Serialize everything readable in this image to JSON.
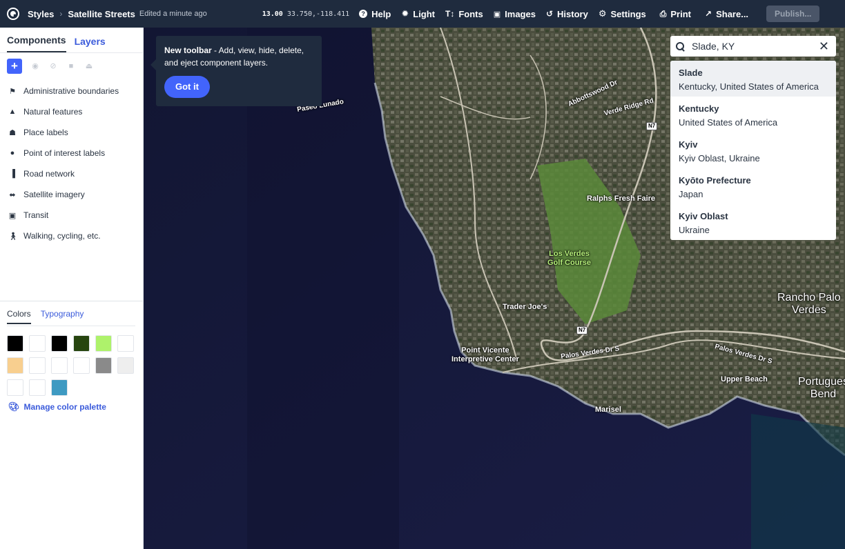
{
  "topbar": {
    "breadcrumb_root": "Styles",
    "style_name": "Satellite Streets",
    "edited": "Edited a minute ago",
    "zoom": "13.00",
    "coords": "33.750,-118.411",
    "buttons": {
      "help": "Help",
      "light": "Light",
      "fonts": "Fonts",
      "images": "Images",
      "history": "History",
      "settings": "Settings",
      "print": "Print",
      "share": "Share...",
      "publish": "Publish..."
    }
  },
  "sidebar": {
    "tabs": [
      "Components",
      "Layers"
    ],
    "components": [
      {
        "label": "Administrative boundaries",
        "icon": "flag-icon"
      },
      {
        "label": "Natural features",
        "icon": "mountain-icon"
      },
      {
        "label": "Place labels",
        "icon": "city-icon"
      },
      {
        "label": "Point of interest labels",
        "icon": "pin-icon"
      },
      {
        "label": "Road network",
        "icon": "road-icon"
      },
      {
        "label": "Satellite imagery",
        "icon": "satellite-icon"
      },
      {
        "label": "Transit",
        "icon": "transit-icon"
      },
      {
        "label": "Walking, cycling, etc.",
        "icon": "walking-icon"
      }
    ],
    "subtabs": [
      "Colors",
      "Typography"
    ],
    "colors": [
      "#000000",
      "#ffffff",
      "#000000",
      "#27450f",
      "#aef26b",
      "#ffffff",
      "#f8cf8f",
      "#ffffff",
      "#ffffff",
      "#ffffff",
      "#8a8a8a",
      "#eeeeee",
      "#ffffff",
      "#ffffff",
      "#3e9ac2"
    ],
    "manage_palette": "Manage color palette"
  },
  "tooltip": {
    "title": "New toolbar",
    "body": " - Add, view, hide, delete, and eject component layers.",
    "button": "Got it"
  },
  "search": {
    "value": "Slade, KY",
    "results": [
      {
        "title": "Slade",
        "subtitle": "Kentucky, United States of America"
      },
      {
        "title": "Kentucky",
        "subtitle": "United States of America"
      },
      {
        "title": "Kyiv",
        "subtitle": "Kyiv Oblast, Ukraine"
      },
      {
        "title": "Kyōto Prefecture",
        "subtitle": "Japan"
      },
      {
        "title": "Kyiv Oblast",
        "subtitle": "Ukraine"
      }
    ]
  },
  "map_labels": {
    "ralphs": "Ralphs Fresh Faire",
    "los_verdes": "Los Verdes\nGolf Course",
    "rancho": "Rancho Palo\nVerdes",
    "trader": "Trader Joe's",
    "point_vicente": "Point Vicente\nInterpretive Center",
    "upper_beach": "Upper Beach",
    "portuguese": "Portugues\nBend",
    "marisel": "Marisel",
    "paseo": "Paseo Lunado",
    "verde_ridge": "Verde Ridge Rd",
    "abbottswood": "Abbottswood Dr",
    "pvd": "Palos Verdes Dr S",
    "pvd2": "Palos Verdes Dr S",
    "n7": "N7"
  }
}
